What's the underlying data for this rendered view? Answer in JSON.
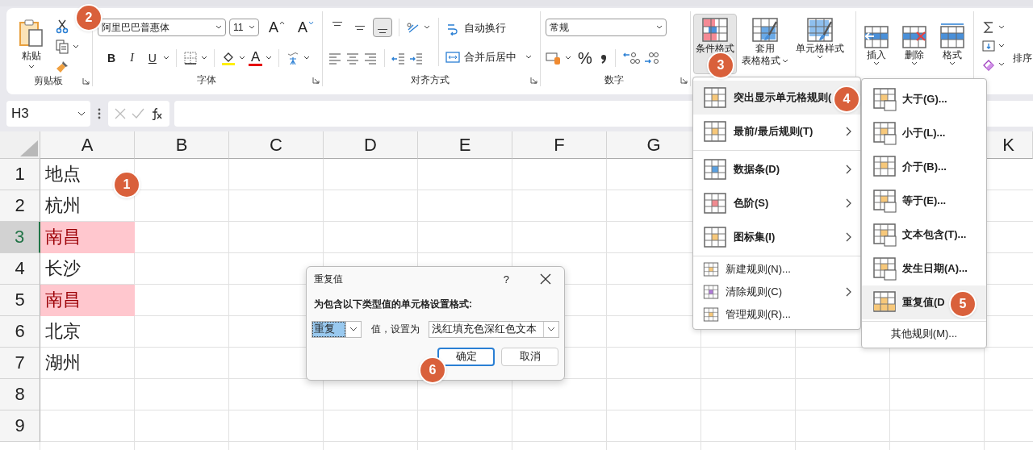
{
  "ribbon": {
    "clipboard": {
      "paste_label": "粘贴",
      "group_label": "剪贴板"
    },
    "font": {
      "font_name": "阿里巴巴普惠体",
      "font_size": "11",
      "grow_glyph": "A",
      "shrink_glyph": "A",
      "bold_glyph": "B",
      "italic_glyph": "I",
      "underline_glyph": "U",
      "color_glyph": "A",
      "group_label": "字体"
    },
    "alignment": {
      "vertical": [
        {
          "selected": false
        },
        {
          "selected": false
        },
        {
          "selected": true
        }
      ],
      "wrap_label": "自动换行",
      "merge_label": "合并后居中",
      "group_label": "对齐方式"
    },
    "number": {
      "format": "常规",
      "percent_glyph": "%",
      "group_label": "数字"
    },
    "styles": {
      "buttons": [
        {
          "label_lines": [
            "条件格式"
          ],
          "selected": true
        },
        {
          "label_lines": [
            "套用",
            "表格格式"
          ],
          "selected": false
        },
        {
          "label_lines": [
            "单元格样式"
          ],
          "selected": false
        }
      ]
    },
    "cells": {
      "buttons": [
        {
          "label": "插入"
        },
        {
          "label": "删除"
        },
        {
          "label": "格式"
        }
      ]
    },
    "editing": {
      "sort_label": "排序"
    }
  },
  "formula_bar": {
    "name_box": "H3"
  },
  "sheet": {
    "columns": [
      "A",
      "B",
      "C",
      "D",
      "E",
      "F",
      "G",
      "K"
    ],
    "rows": [
      {
        "number": "1",
        "selected": false,
        "cell": {
          "text": "地点",
          "highlighted": false
        }
      },
      {
        "number": "2",
        "selected": false,
        "cell": {
          "text": "杭州",
          "highlighted": false
        }
      },
      {
        "number": "3",
        "selected": true,
        "cell": {
          "text": "南昌",
          "highlighted": true
        }
      },
      {
        "number": "4",
        "selected": false,
        "cell": {
          "text": "长沙",
          "highlighted": false
        }
      },
      {
        "number": "5",
        "selected": false,
        "cell": {
          "text": "南昌",
          "highlighted": true
        }
      },
      {
        "number": "6",
        "selected": false,
        "cell": {
          "text": "北京",
          "highlighted": false
        }
      },
      {
        "number": "7",
        "selected": false,
        "cell": {
          "text": "湖州",
          "highlighted": false
        }
      },
      {
        "number": "8",
        "selected": false
      },
      {
        "number": "9",
        "selected": false
      }
    ]
  },
  "cf_menu": {
    "sections": [
      {
        "items": [
          {
            "kind": "large",
            "label": "突出显示单元格规则(",
            "submenu": false,
            "selected": true
          },
          {
            "kind": "large",
            "label": "最前/最后规则(T)",
            "submenu": true,
            "selected": false
          }
        ]
      },
      {
        "items": [
          {
            "kind": "large",
            "label": "数据条(D)",
            "submenu": true,
            "selected": false
          },
          {
            "kind": "large",
            "label": "色阶(S)",
            "submenu": true,
            "selected": false
          },
          {
            "kind": "large",
            "label": "图标集(I)",
            "submenu": true,
            "selected": false
          }
        ]
      },
      {
        "items": [
          {
            "kind": "small",
            "label": "新建规则(N)...",
            "submenu": false,
            "selected": false
          },
          {
            "kind": "small",
            "label": "清除规则(C)",
            "submenu": true,
            "selected": false
          },
          {
            "kind": "small",
            "label": "管理规则(R)...",
            "submenu": false,
            "selected": false
          }
        ]
      }
    ]
  },
  "submenu": {
    "items": [
      {
        "label": "大于(G)...",
        "selected": false
      },
      {
        "label": "小于(L)...",
        "selected": false
      },
      {
        "label": "介于(B)...",
        "selected": false
      },
      {
        "label": "等于(E)...",
        "selected": false
      },
      {
        "label": "文本包含(T)...",
        "selected": false
      },
      {
        "label": "发生日期(A)...",
        "selected": false
      },
      {
        "label": "重复值(D",
        "selected": true
      }
    ],
    "footer": "其他规则(M)..."
  },
  "dialog": {
    "title": "重复值",
    "help": "?",
    "prompt": "为包含以下类型值的单元格设置格式:",
    "type_value": "重复",
    "type_text_selected": true,
    "middle_label": "值，设置为",
    "format_value": "浅红填充色深红色文本",
    "buttons": [
      {
        "label": "确定",
        "default": true
      },
      {
        "label": "取消",
        "default": false
      }
    ]
  },
  "badges": [
    "1",
    "2",
    "3",
    "4",
    "5",
    "6"
  ]
}
